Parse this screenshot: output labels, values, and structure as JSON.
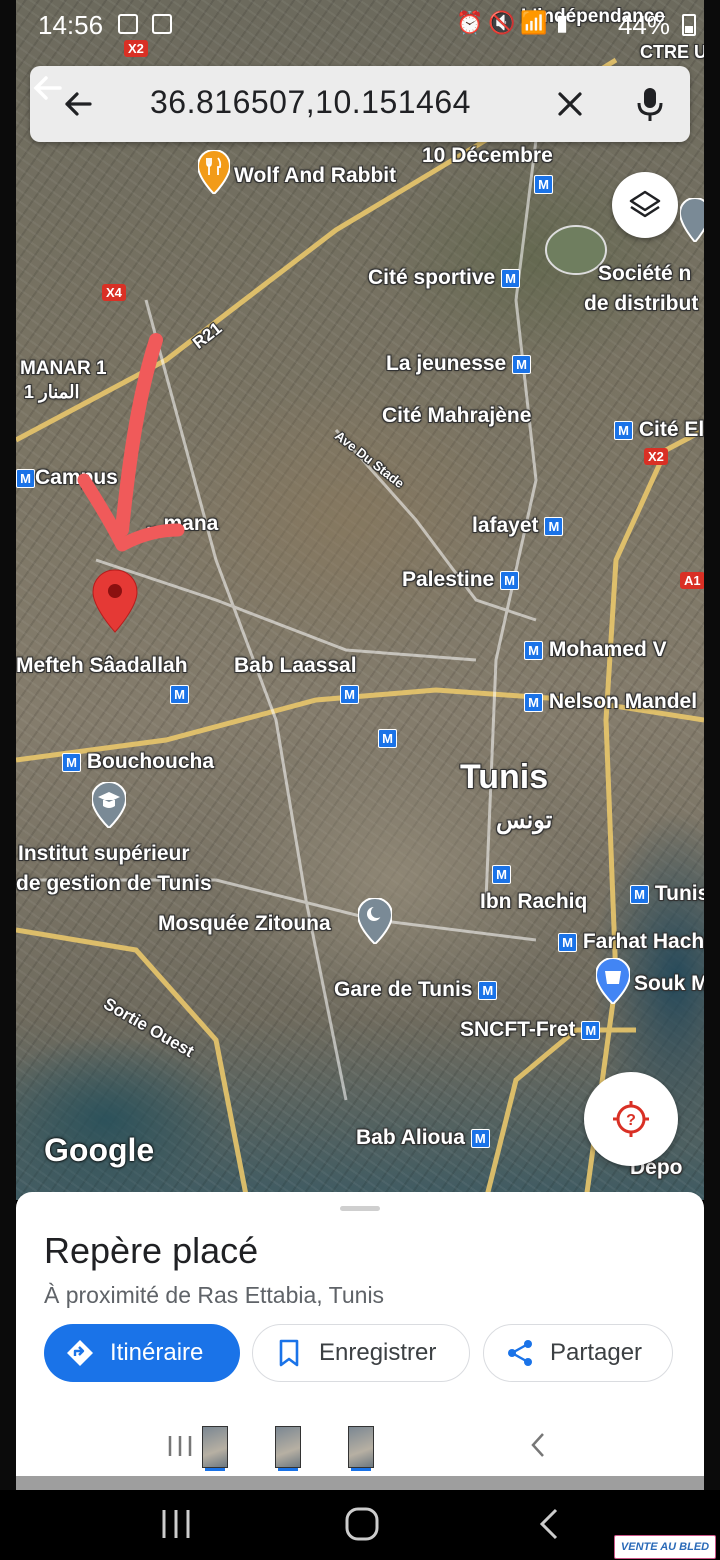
{
  "status_bar": {
    "time": "14:56",
    "battery": "44%",
    "notification_icons": [
      "photo-notification-icon",
      "gallery-notification-icon"
    ],
    "system_icons": [
      "alarm-icon",
      "mute-icon",
      "wifi-icon",
      "signal-icon"
    ]
  },
  "search": {
    "query": "36.816507,10.151464"
  },
  "map": {
    "labels": {
      "wolf_and_rabbit": "Wolf And Rabbit",
      "dix_decembre": "10 Décembre",
      "cite_sportive": "Cité sportive",
      "societe_1": "Société n",
      "societe_2": "de distribut",
      "la_jeunesse": "La jeunesse",
      "cite_mahrajene": "Cité Mahrajène",
      "cite_el": "Cité El",
      "manar_1": "MANAR 1",
      "manar_ar": "المنار 1",
      "campus": "Campus",
      "ezzouhour": "...mana",
      "ave_du_stade": "Ave Du Stade",
      "lafayet": "lafayet",
      "palestine": "Palestine",
      "mefteh": "Mefteh Sâadallah",
      "bab_laassal": "Bab Laassal",
      "mohamed_v": "Mohamed V",
      "nelson_mandela": "Nelson Mandel",
      "bouchoucha": "Bouchoucha",
      "tunis": "Tunis",
      "tunis_ar": "تونس",
      "institut_1": "Institut supérieur",
      "institut_2": "de gestion de Tunis",
      "ibn_rachiq": "Ibn Rachiq",
      "tunis_station": "Tunis",
      "farhat_hached": "Farhat Hach",
      "mosquee_zitouna": "Mosquée Zitouna",
      "souk": "Souk M",
      "gare_de_tunis": "Gare de Tunis",
      "sncft_fret": "SNCFT-Fret",
      "sortie_ouest": "Sortie Ouest",
      "bab_alioua": "Bab Alioua",
      "depot": "Dépo",
      "independance": "L'indépendance",
      "ctre_u": "CTRE U",
      "metro_letter": "M"
    },
    "road_shields": {
      "x2_top": "X2",
      "x4": "X4",
      "r21": "R21",
      "x2_right": "X2",
      "a1": "A1"
    },
    "google_logo": "Google"
  },
  "place_sheet": {
    "title": "Repère placé",
    "subtitle": "À proximité de Ras Ettabia, Tunis",
    "directions_label": "Itinéraire",
    "save_label": "Enregistrer",
    "share_label": "Partager"
  },
  "watermark": "VENTE AU BLED",
  "accent_colors": {
    "primary_blue": "#1a73e8",
    "marker_red": "#e53935",
    "annotation_red": "#f05a5a"
  }
}
